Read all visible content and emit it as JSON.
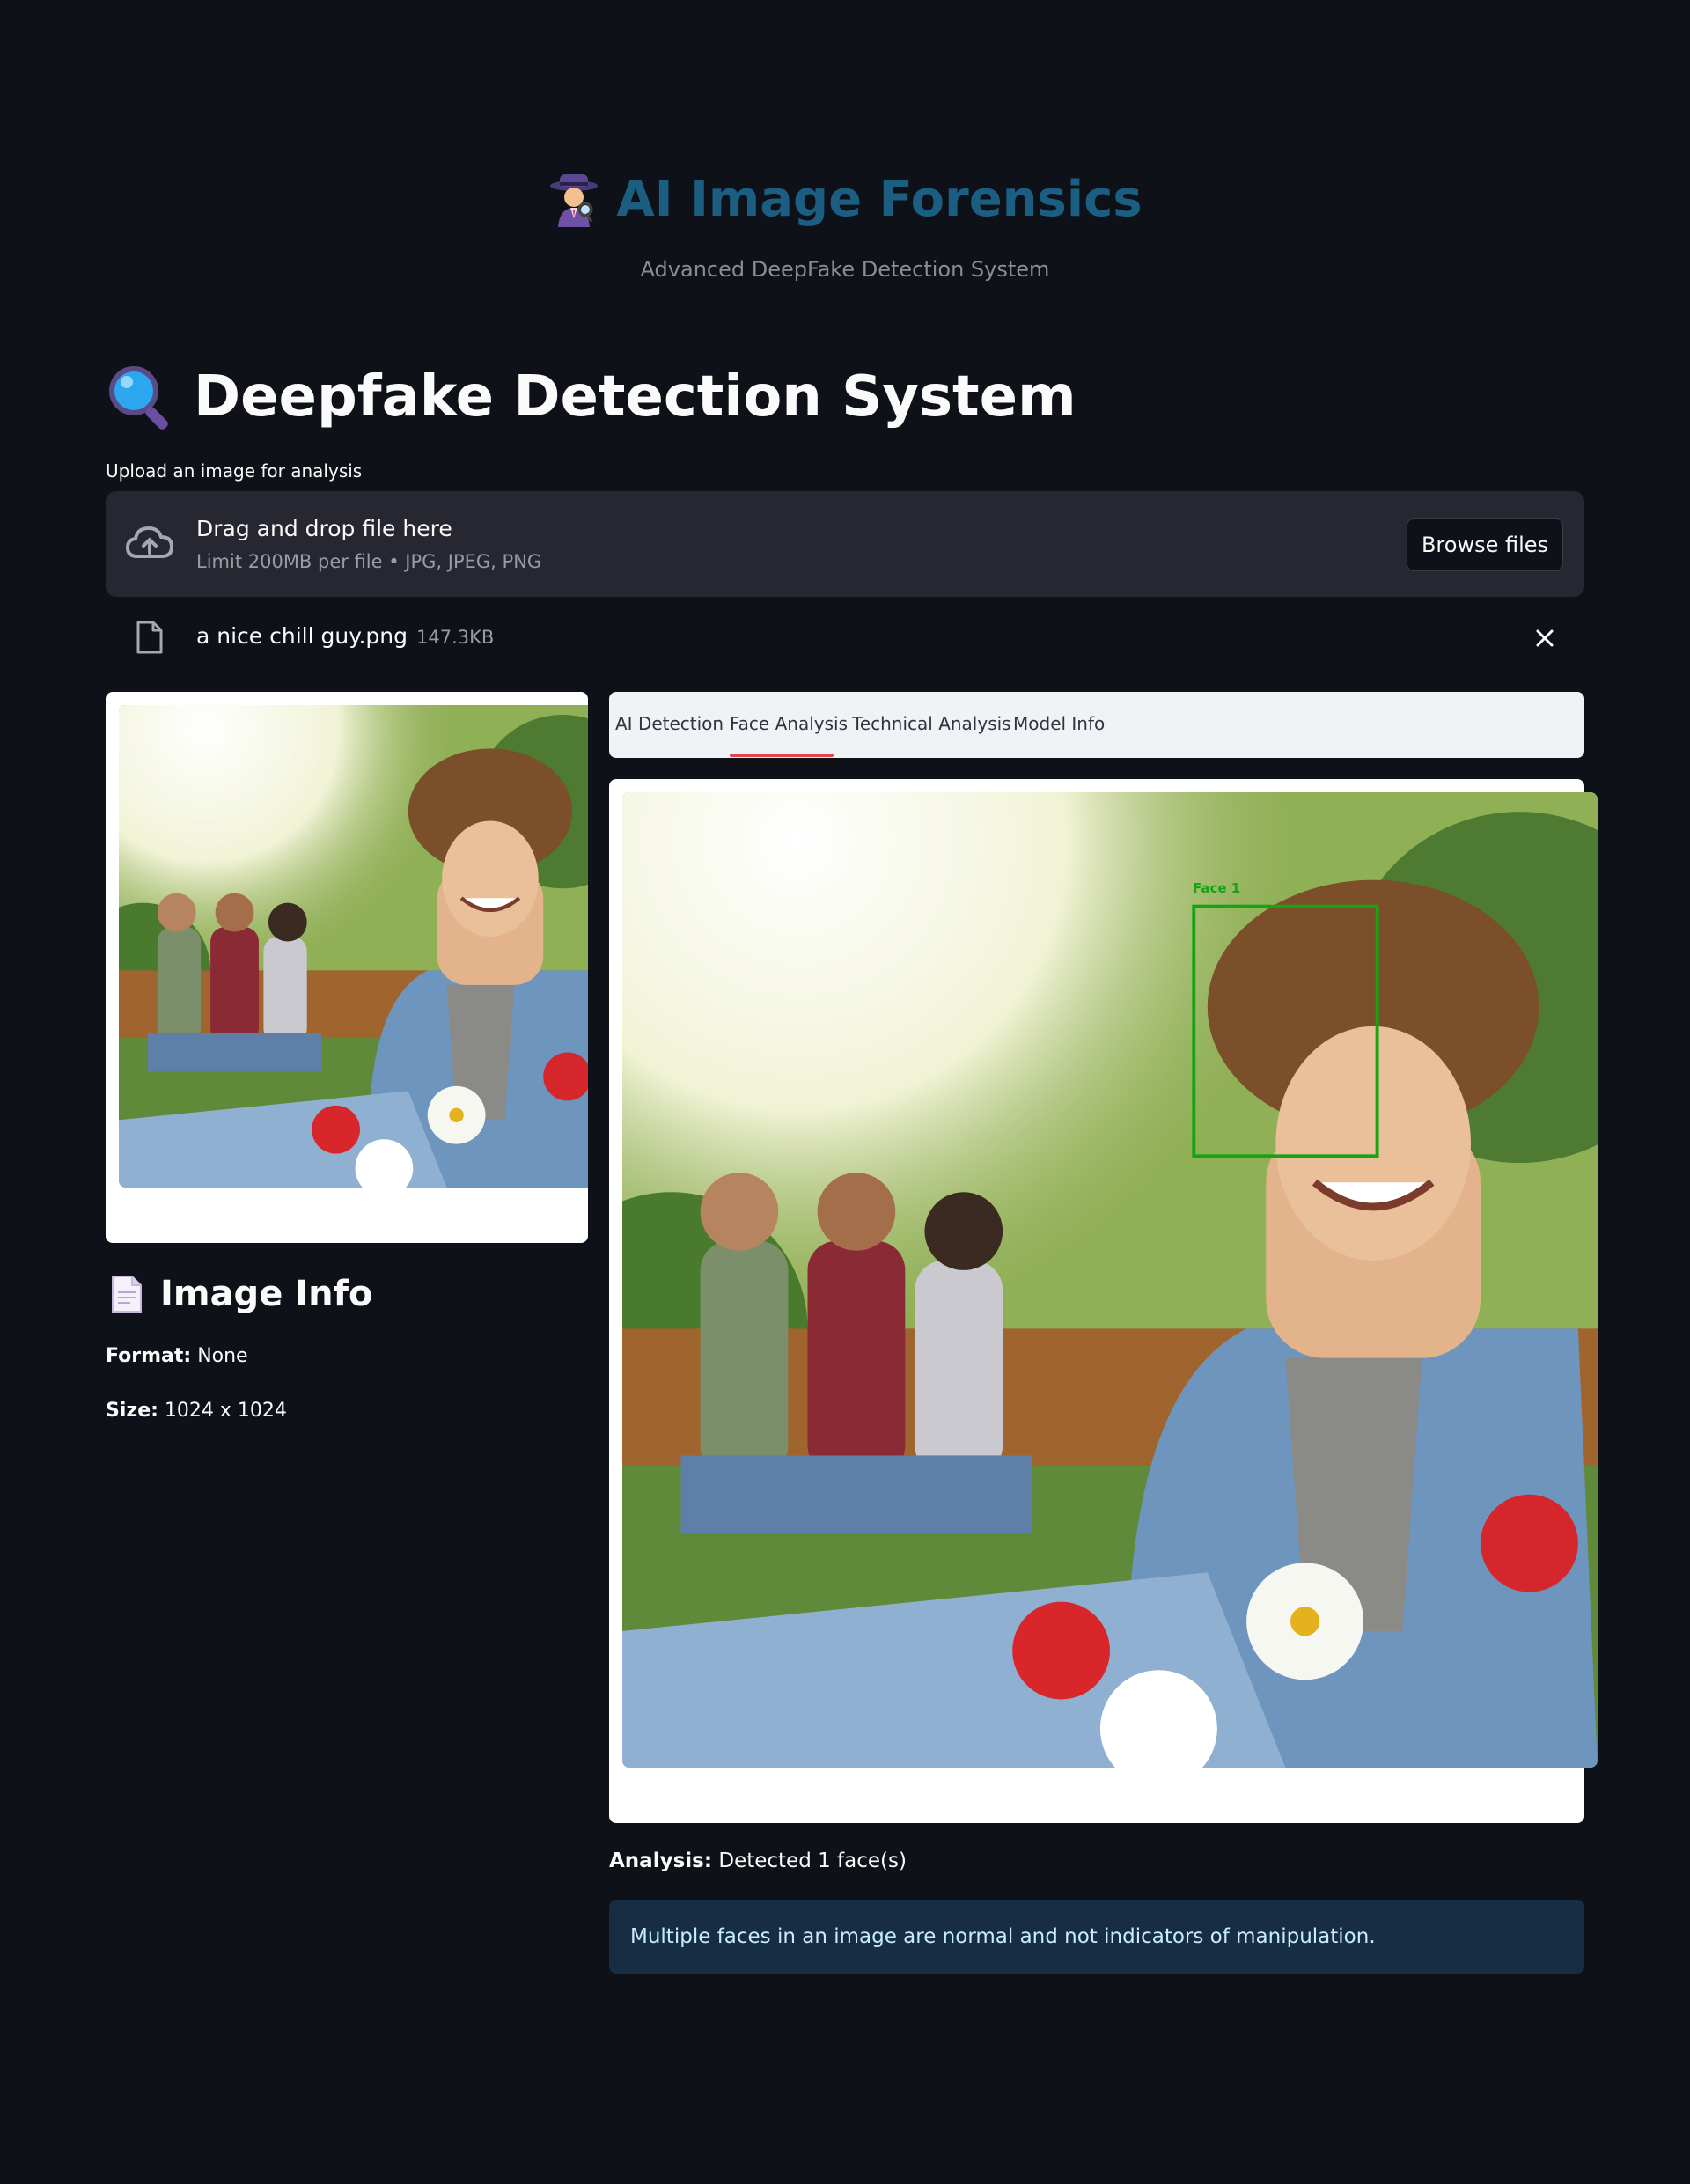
{
  "header": {
    "title": "AI Image Forensics",
    "subtitle": "Advanced DeepFake Detection System",
    "icon": "detective-emoji-icon"
  },
  "section": {
    "title": "Deepfake Detection System",
    "icon": "magnifier-emoji-icon"
  },
  "uploader": {
    "label": "Upload an image for analysis",
    "drop_text": "Drag and drop file here",
    "limit_text": "Limit 200MB per file • JPG, JPEG, PNG",
    "browse_label": "Browse files",
    "file": {
      "name": "a nice chill guy.png",
      "size": "147.3KB"
    }
  },
  "image_info": {
    "title": "Image Info",
    "icon": "document-emoji-icon",
    "format_label": "Format:",
    "format_value": "None",
    "size_label": "Size:",
    "size_value": "1024 x 1024"
  },
  "tabs": [
    {
      "label": "AI Detection",
      "active": false
    },
    {
      "label": "Face Analysis",
      "active": true
    },
    {
      "label": "Technical Analysis",
      "active": false
    },
    {
      "label": "Model Info",
      "active": false
    }
  ],
  "face_analysis": {
    "face_label": "Face 1",
    "analysis_label": "Analysis:",
    "analysis_value": "Detected 1 face(s)",
    "note": "Multiple faces in an image are normal and not indicators of manipulation."
  },
  "colors": {
    "background": "#0e1117",
    "title_blue": "#1c5e82",
    "tab_underline": "#e0454b",
    "info_box_bg": "#172d43",
    "info_box_text": "#c7ebff",
    "face_box": "#16a316"
  }
}
